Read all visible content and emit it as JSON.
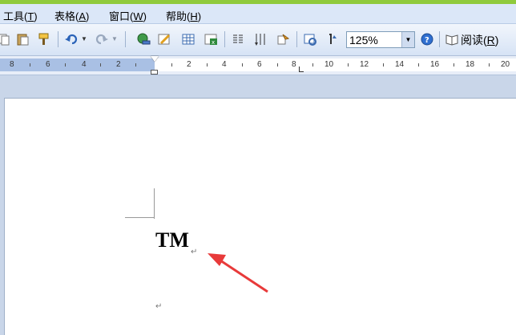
{
  "menu": [
    {
      "label": "工具(",
      "key": "T",
      "end": ")"
    },
    {
      "label": "表格(",
      "key": "A",
      "end": ")"
    },
    {
      "label": "窗口(",
      "key": "W",
      "end": ")"
    },
    {
      "label": "帮助(",
      "key": "H",
      "end": ")"
    }
  ],
  "toolbar": {
    "zoom_value": "125%",
    "reading_label": "阅读(",
    "reading_key": "R",
    "reading_end": ")"
  },
  "ruler": {
    "left_numbers": [
      "8",
      "6",
      "4",
      "2"
    ],
    "right_numbers": [
      "2",
      "4",
      "6",
      "8",
      "10",
      "12",
      "14",
      "16",
      "18",
      "20"
    ]
  },
  "document": {
    "text": "TM",
    "paragraph_mark": "↵"
  },
  "colors": {
    "annotation_arrow": "#e83a3a",
    "window_top": "#8fca3d"
  }
}
